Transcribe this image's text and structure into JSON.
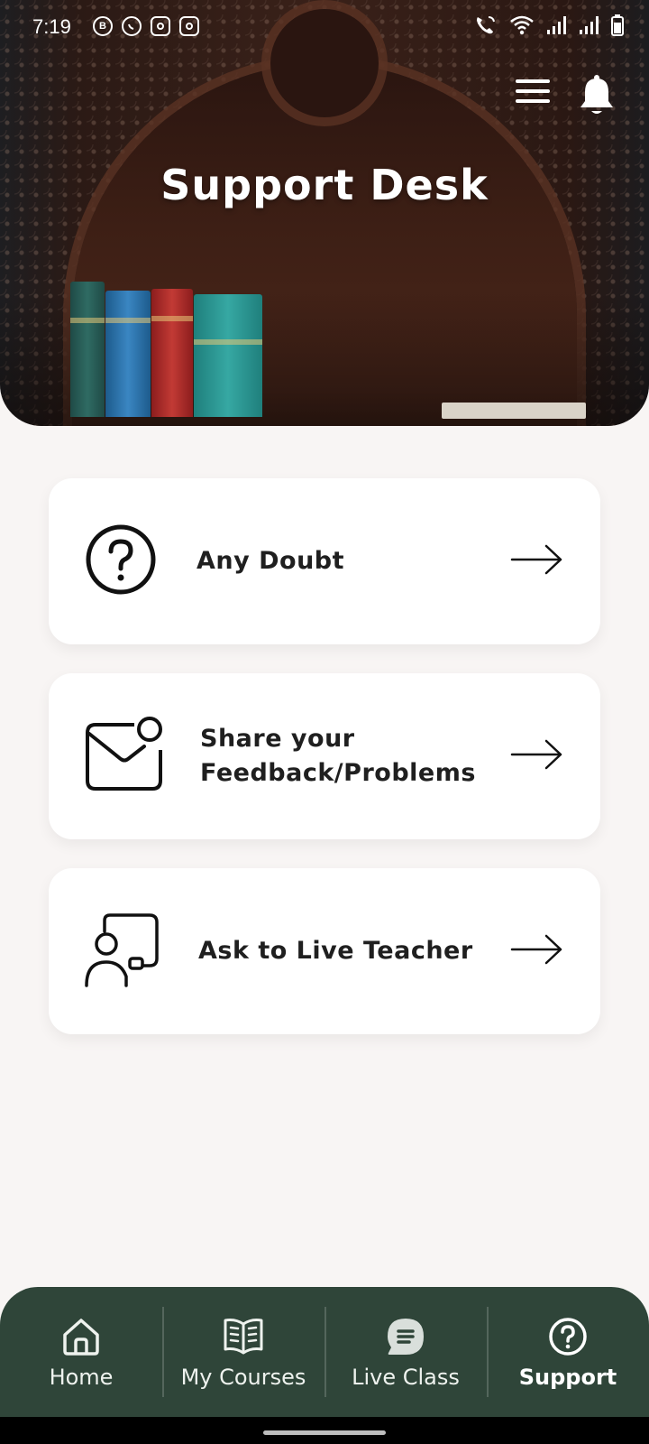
{
  "status_bar": {
    "time": "7:19",
    "app_icons": [
      "b-icon",
      "whatsapp-icon",
      "instagram-icon",
      "instagram-icon"
    ],
    "right_icons": [
      "wifi-call-icon",
      "wifi-icon",
      "signal-icon",
      "signal-icon",
      "battery-icon"
    ]
  },
  "header": {
    "title": "Support Desk",
    "menu_icon": "hamburger-icon",
    "bell_icon": "bell-icon"
  },
  "cards": [
    {
      "label": "Any Doubt",
      "icon": "question-circle-icon",
      "arrow": "arrow-right-icon"
    },
    {
      "label_line1": "Share your",
      "label_line2": "Feedback/Problems",
      "icon": "mail-notification-icon",
      "arrow": "arrow-right-icon"
    },
    {
      "label": "Ask to Live Teacher",
      "icon": "teacher-board-icon",
      "arrow": "arrow-right-icon"
    }
  ],
  "bottom_nav": {
    "items": [
      {
        "label": "Home",
        "icon": "home-icon",
        "active": false
      },
      {
        "label": "My Courses",
        "icon": "book-icon",
        "active": false
      },
      {
        "label": "Live Class",
        "icon": "chat-bubble-icon",
        "active": false
      },
      {
        "label": "Support",
        "icon": "question-circle-icon",
        "active": true
      }
    ]
  },
  "colors": {
    "background": "#f8f5f4",
    "nav_background": "#2f4539",
    "card_background": "#ffffff",
    "text": "#1f1f1f"
  }
}
